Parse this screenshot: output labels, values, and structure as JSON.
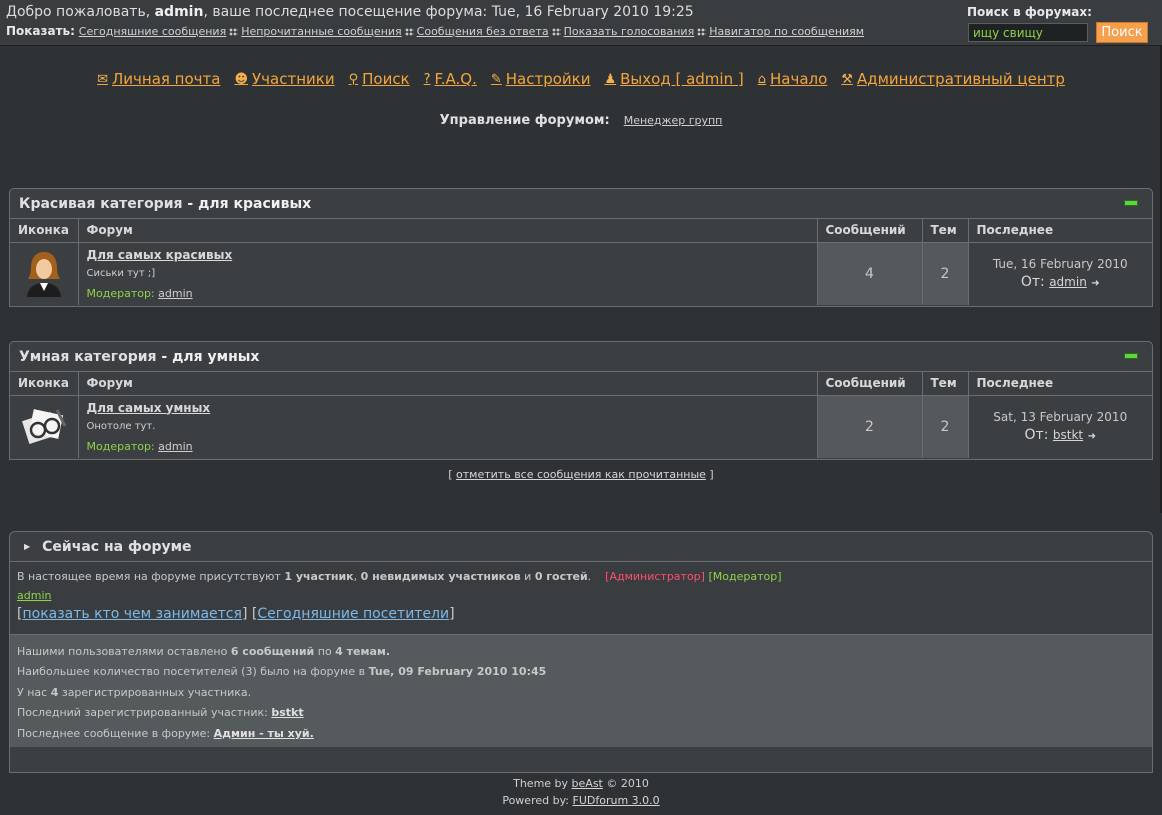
{
  "header": {
    "welcome_prefix": "Добро пожаловать,",
    "user": "admin",
    "welcome_suffix": ", ваше последнее посещение форума: Tue, 16 February 2010 19:25",
    "show_label": "Показать:",
    "links": [
      "Сегодняшние сообщения",
      "Непрочитанные сообщения",
      "Сообщения без ответа",
      "Показать голосования",
      "Навигатор по сообщениям"
    ],
    "search_label": "Поиск в форумах:",
    "search_value": "ищу свищу",
    "search_button": "Поиск"
  },
  "nav": [
    {
      "label": "Личная почта",
      "icon": "mail-icon",
      "glyph": "✉"
    },
    {
      "label": "Участники",
      "icon": "members-icon",
      "glyph": "☻"
    },
    {
      "label": "Поиск",
      "icon": "search-icon",
      "glyph": "⚲"
    },
    {
      "label": "F.A.Q.",
      "icon": "faq-icon",
      "glyph": "?"
    },
    {
      "label": "Настройки",
      "icon": "wrench-icon",
      "glyph": "✎"
    },
    {
      "label": "Выход [ admin ]",
      "icon": "logout-icon",
      "glyph": "♟"
    },
    {
      "label": "Начало",
      "icon": "home-icon",
      "glyph": "⌂"
    },
    {
      "label": "Административный центр",
      "icon": "admin-tools-icon",
      "glyph": "⚒"
    }
  ],
  "management": {
    "label": "Управление форумом:",
    "link": "Менеджер групп"
  },
  "columns": {
    "icon": "Иконка",
    "forum": "Форум",
    "posts": "Сообщений",
    "topics": "Тем",
    "last": "Последнее"
  },
  "categories": [
    {
      "title": "Красивая категория",
      "desc": "- для красивых",
      "forum": {
        "name": "Для самых красивых",
        "desc": "Сиськи тут ;]",
        "mod_label": "Модератор:",
        "mod": "admin",
        "posts": "4",
        "topics": "2",
        "last_date": "Tue, 16 February 2010",
        "from_label": "От:",
        "last_user": "admin"
      }
    },
    {
      "title": "Умная категория",
      "desc": "- для умных",
      "forum": {
        "name": "Для самых умных",
        "desc": "Онотоле тут.",
        "mod_label": "Модератор:",
        "mod": "admin",
        "posts": "2",
        "topics": "2",
        "last_date": "Sat, 13 February 2010",
        "from_label": "От:",
        "last_user": "bstkt"
      }
    }
  ],
  "mark_read": {
    "open": "[ ",
    "link": "отметить все сообщения как прочитанные",
    "close": " ]"
  },
  "online": {
    "title": "Сейчас на форуме",
    "line_prefix": "В настоящее время на форуме присутствуют",
    "members": "1 участник",
    "hidden": "0 невидимых участников",
    "and": "и",
    "guests": "0 гостей",
    "legend_admin": "[Администратор]",
    "legend_mod": "[Модератор]",
    "user": "admin",
    "link_activity": "показать кто чем занимается",
    "link_today": "Сегодняшние посетители"
  },
  "stats": {
    "l1_a": "Нашими пользователями оставлено",
    "l1_posts": "6 сообщений",
    "l1_b": "по",
    "l1_topics": "4 темам.",
    "l2_a": "Наибольшее количество посетителей (3) было на форуме в",
    "l2_date": "Tue, 09 February 2010 10:45",
    "l3_a": "У нас",
    "l3_num": "4",
    "l3_b": "зарегистрированных участника.",
    "l4_a": "Последний зарегистрированный участник:",
    "l4_user": "bstkt",
    "l5_a": "Последнее сообщение в форуме:",
    "l5_link": "Админ - ты хуй."
  },
  "footer": {
    "theme_a": "Theme by",
    "theme_link": "beAst",
    "theme_b": "© 2010",
    "powered_a": "Powered by:",
    "powered_link": "FUDforum 3.0.0"
  }
}
